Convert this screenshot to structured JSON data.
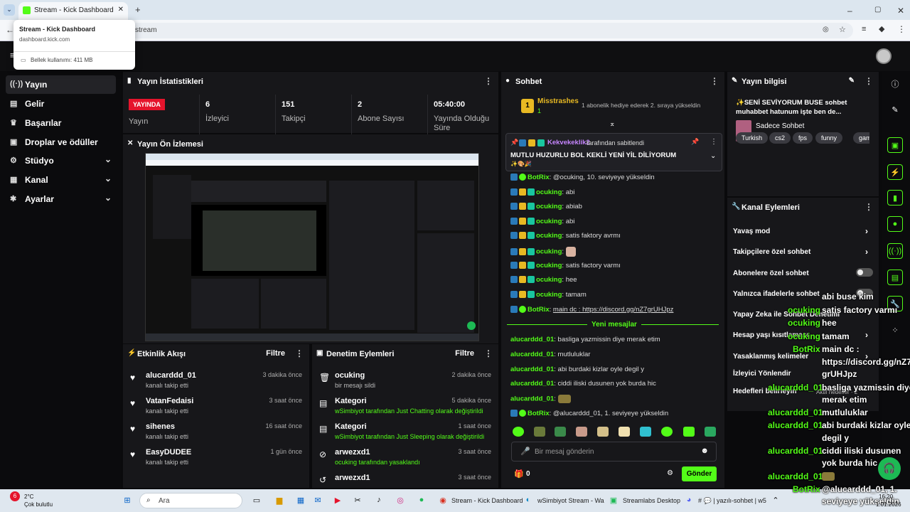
{
  "browser": {
    "tab_title": "Stream - Kick Dashboard",
    "url_fragment": "stream",
    "popup": {
      "title": "Stream - Kick Dashboard",
      "domain": "dashboard.kick.com",
      "memory": "Bellek kullanımı: 411 MB"
    }
  },
  "sidebar": {
    "items": [
      {
        "label": "Yayın",
        "icon": "stream-icon"
      },
      {
        "label": "Gelir",
        "icon": "revenue-icon"
      },
      {
        "label": "Başarılar",
        "icon": "trophy-icon"
      },
      {
        "label": "Droplar ve ödüller",
        "icon": "gift-icon"
      },
      {
        "label": "Stüdyo",
        "icon": "studio-icon"
      },
      {
        "label": "Kanal",
        "icon": "channel-icon"
      },
      {
        "label": "Ayarlar",
        "icon": "gear-icon"
      }
    ]
  },
  "stats": {
    "title": "Yayın İstatistikleri",
    "live": "YAYINDA",
    "live_label": "Yayın",
    "items": [
      {
        "value": "6",
        "label": "İzleyici"
      },
      {
        "value": "151",
        "label": "Takipçi"
      },
      {
        "value": "2",
        "label": "Abone Sayısı"
      },
      {
        "value": "05:40:00",
        "label": "Yayında Olduğu Süre"
      }
    ]
  },
  "preview": {
    "title": "Yayın Ön İzlemesi"
  },
  "activity": {
    "title": "Etkinlik Akışı",
    "filter": "Filtre",
    "items": [
      {
        "name": "alucarddd_01",
        "desc": "kanalı takip etti",
        "time": "3 dakika önce"
      },
      {
        "name": "VatanFedaisi",
        "desc": "kanalı takip etti",
        "time": "3 saat önce"
      },
      {
        "name": "sihenes",
        "desc": "kanalı takip etti",
        "time": "16 saat önce"
      },
      {
        "name": "EasyDUDEE",
        "desc": "kanalı takip etti",
        "time": "1 gün önce"
      }
    ]
  },
  "moderation": {
    "title": "Denetim Eylemleri",
    "filter": "Filtre",
    "items": [
      {
        "name": "ocuking",
        "desc": "bir mesajı sildi",
        "time": "2 dakika önce"
      },
      {
        "name": "Kategori",
        "desc": "wSimbiyot tarafından Just Chatting olarak değiştirildi",
        "time": "5 dakika önce"
      },
      {
        "name": "Kategori",
        "desc": "wSimbiyot tarafından Just Sleeping olarak değiştirildi",
        "time": "1 saat önce"
      },
      {
        "name": "arwezxd1",
        "desc": "ocuking tarafından yasaklandı",
        "time": "3 saat önce"
      },
      {
        "name": "arwezxd1",
        "desc": "",
        "time": "3 saat önce"
      }
    ]
  },
  "chat": {
    "title": "Sohbet",
    "gifter": "Misstrashes",
    "gift_count": "1",
    "gift_text": "1 abonelik hediye ederek 2. sıraya yükseldin",
    "pinned_by": "Kekvekeklik2",
    "pinned_suffix": "tarafından sabitlendi",
    "pinned_msg": "MUTLU HUZURLU BOL KEKLİ YENİ YİL DİLİYORUM",
    "new_messages": "Yeni mesajlar",
    "input_placeholder": "Bir mesaj gönderin",
    "points": "0",
    "send": "Gönder",
    "messages": [
      {
        "user": "BotRix",
        "text": "@ocuking, 10. seviyeye yükseldin"
      },
      {
        "user": "ocuking",
        "text": "abi"
      },
      {
        "user": "ocuking",
        "text": "abiab"
      },
      {
        "user": "ocuking",
        "text": "abi"
      },
      {
        "user": "ocuking",
        "text": "satis faktory avrmı"
      },
      {
        "user": "ocuking",
        "text": ""
      },
      {
        "user": "ocuking",
        "text": "satis factory varmı"
      },
      {
        "user": "ocuking",
        "text": "hee"
      },
      {
        "user": "ocuking",
        "text": "tamam"
      },
      {
        "user": "BotRix",
        "text": "main dc : https://discord.gg/nZ7grUHJpz"
      }
    ],
    "new_msgs": [
      {
        "user": "alucarddd_01",
        "text": "basliga yazmissin diye merak etim"
      },
      {
        "user": "alucarddd_01",
        "text": "mutluluklar"
      },
      {
        "user": "alucarddd_01",
        "text": "abi burdaki kizlar oyle degil y"
      },
      {
        "user": "alucarddd_01",
        "text": "ciddi iliski dusunen yok burda hic"
      },
      {
        "user": "alucarddd_01",
        "text": ""
      },
      {
        "user": "BotRix",
        "text": "@alucarddd_01, 1. seviyeye yükseldin"
      }
    ]
  },
  "info": {
    "title": "Yayın bilgisi",
    "stream_title": "✨SENİ SEVİYORUM BUSE sohbet muhabbet hatunum işte ben de...",
    "category": "Sadece Sohbet",
    "tags": [
      "Turkish",
      "cs2",
      "fps",
      "funny",
      "gam"
    ]
  },
  "actions": {
    "title": "Kanal Eylemleri",
    "items": [
      "Yavaş mod",
      "Takipçilere özel sohbet",
      "Abonelere özel sohbet",
      "Yalnızca ifadelerle sohbet",
      "Yapay Zeka ile Sohbet Denetimi",
      "Hesap yaşı kısıtlaması",
      "Yasaklanmış kelimeler",
      "İzleyici Yönlendir",
      "Hedefleri belirleyin"
    ],
    "active_goal": "Aktif hedefler · 2"
  },
  "overlay": [
    {
      "user": "",
      "text": "abi buse kim"
    },
    {
      "user": "ocuking",
      "text": "satis factory varmı"
    },
    {
      "user": "ocuking",
      "text": "hee"
    },
    {
      "user": "ocuking",
      "text": "tamam"
    },
    {
      "user": "BotRix",
      "text": "main dc :"
    },
    {
      "user": "",
      "text": "https://discord.gg/nZ7"
    },
    {
      "user": "",
      "text": "grUHJpz"
    },
    {
      "user": "alucarddd_01",
      "text": "basliga yazmissin diye"
    },
    {
      "user": "",
      "text": "merak etim"
    },
    {
      "user": "alucarddd_01",
      "text": "mutluluklar"
    },
    {
      "user": "alucarddd_01",
      "text": "abi burdaki kizlar oyle"
    },
    {
      "user": "",
      "text": "degil y"
    },
    {
      "user": "alucarddd_01",
      "text": "ciddi iliski dusunen"
    },
    {
      "user": "",
      "text": "yok burda hic"
    },
    {
      "user": "alucarddd_01",
      "text": ""
    },
    {
      "user": "BotRix",
      "text": "@alucarddd_01, 1."
    },
    {
      "user": "",
      "text": "seviyeye yükseldin"
    }
  ],
  "taskbar": {
    "weather_temp": "2°C",
    "weather_desc": "Çok bulutlu",
    "weather_badge": "6",
    "search": "Ara",
    "apps": [
      "Stream - Kick Dashboard",
      "wSimbiyot Stream - Wa",
      "Streamlabs Desktop",
      "# 💬 | yazılı-sohbet | w5"
    ],
    "time": "16:20",
    "date": "1.01.2026"
  },
  "colors": {
    "kick_green": "#53fc18",
    "live_red": "#e5142c",
    "panel": "#17171a"
  }
}
